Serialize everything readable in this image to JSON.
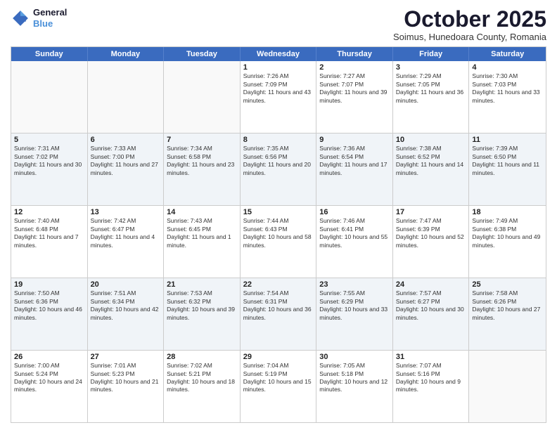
{
  "header": {
    "logo_line1": "General",
    "logo_line2": "Blue",
    "month": "October 2025",
    "location": "Soimus, Hunedoara County, Romania"
  },
  "weekdays": [
    "Sunday",
    "Monday",
    "Tuesday",
    "Wednesday",
    "Thursday",
    "Friday",
    "Saturday"
  ],
  "rows": [
    [
      {
        "day": "",
        "info": ""
      },
      {
        "day": "",
        "info": ""
      },
      {
        "day": "",
        "info": ""
      },
      {
        "day": "1",
        "info": "Sunrise: 7:26 AM\nSunset: 7:09 PM\nDaylight: 11 hours and 43 minutes."
      },
      {
        "day": "2",
        "info": "Sunrise: 7:27 AM\nSunset: 7:07 PM\nDaylight: 11 hours and 39 minutes."
      },
      {
        "day": "3",
        "info": "Sunrise: 7:29 AM\nSunset: 7:05 PM\nDaylight: 11 hours and 36 minutes."
      },
      {
        "day": "4",
        "info": "Sunrise: 7:30 AM\nSunset: 7:03 PM\nDaylight: 11 hours and 33 minutes."
      }
    ],
    [
      {
        "day": "5",
        "info": "Sunrise: 7:31 AM\nSunset: 7:02 PM\nDaylight: 11 hours and 30 minutes."
      },
      {
        "day": "6",
        "info": "Sunrise: 7:33 AM\nSunset: 7:00 PM\nDaylight: 11 hours and 27 minutes."
      },
      {
        "day": "7",
        "info": "Sunrise: 7:34 AM\nSunset: 6:58 PM\nDaylight: 11 hours and 23 minutes."
      },
      {
        "day": "8",
        "info": "Sunrise: 7:35 AM\nSunset: 6:56 PM\nDaylight: 11 hours and 20 minutes."
      },
      {
        "day": "9",
        "info": "Sunrise: 7:36 AM\nSunset: 6:54 PM\nDaylight: 11 hours and 17 minutes."
      },
      {
        "day": "10",
        "info": "Sunrise: 7:38 AM\nSunset: 6:52 PM\nDaylight: 11 hours and 14 minutes."
      },
      {
        "day": "11",
        "info": "Sunrise: 7:39 AM\nSunset: 6:50 PM\nDaylight: 11 hours and 11 minutes."
      }
    ],
    [
      {
        "day": "12",
        "info": "Sunrise: 7:40 AM\nSunset: 6:48 PM\nDaylight: 11 hours and 7 minutes."
      },
      {
        "day": "13",
        "info": "Sunrise: 7:42 AM\nSunset: 6:47 PM\nDaylight: 11 hours and 4 minutes."
      },
      {
        "day": "14",
        "info": "Sunrise: 7:43 AM\nSunset: 6:45 PM\nDaylight: 11 hours and 1 minute."
      },
      {
        "day": "15",
        "info": "Sunrise: 7:44 AM\nSunset: 6:43 PM\nDaylight: 10 hours and 58 minutes."
      },
      {
        "day": "16",
        "info": "Sunrise: 7:46 AM\nSunset: 6:41 PM\nDaylight: 10 hours and 55 minutes."
      },
      {
        "day": "17",
        "info": "Sunrise: 7:47 AM\nSunset: 6:39 PM\nDaylight: 10 hours and 52 minutes."
      },
      {
        "day": "18",
        "info": "Sunrise: 7:49 AM\nSunset: 6:38 PM\nDaylight: 10 hours and 49 minutes."
      }
    ],
    [
      {
        "day": "19",
        "info": "Sunrise: 7:50 AM\nSunset: 6:36 PM\nDaylight: 10 hours and 46 minutes."
      },
      {
        "day": "20",
        "info": "Sunrise: 7:51 AM\nSunset: 6:34 PM\nDaylight: 10 hours and 42 minutes."
      },
      {
        "day": "21",
        "info": "Sunrise: 7:53 AM\nSunset: 6:32 PM\nDaylight: 10 hours and 39 minutes."
      },
      {
        "day": "22",
        "info": "Sunrise: 7:54 AM\nSunset: 6:31 PM\nDaylight: 10 hours and 36 minutes."
      },
      {
        "day": "23",
        "info": "Sunrise: 7:55 AM\nSunset: 6:29 PM\nDaylight: 10 hours and 33 minutes."
      },
      {
        "day": "24",
        "info": "Sunrise: 7:57 AM\nSunset: 6:27 PM\nDaylight: 10 hours and 30 minutes."
      },
      {
        "day": "25",
        "info": "Sunrise: 7:58 AM\nSunset: 6:26 PM\nDaylight: 10 hours and 27 minutes."
      }
    ],
    [
      {
        "day": "26",
        "info": "Sunrise: 7:00 AM\nSunset: 5:24 PM\nDaylight: 10 hours and 24 minutes."
      },
      {
        "day": "27",
        "info": "Sunrise: 7:01 AM\nSunset: 5:23 PM\nDaylight: 10 hours and 21 minutes."
      },
      {
        "day": "28",
        "info": "Sunrise: 7:02 AM\nSunset: 5:21 PM\nDaylight: 10 hours and 18 minutes."
      },
      {
        "day": "29",
        "info": "Sunrise: 7:04 AM\nSunset: 5:19 PM\nDaylight: 10 hours and 15 minutes."
      },
      {
        "day": "30",
        "info": "Sunrise: 7:05 AM\nSunset: 5:18 PM\nDaylight: 10 hours and 12 minutes."
      },
      {
        "day": "31",
        "info": "Sunrise: 7:07 AM\nSunset: 5:16 PM\nDaylight: 10 hours and 9 minutes."
      },
      {
        "day": "",
        "info": ""
      }
    ]
  ]
}
